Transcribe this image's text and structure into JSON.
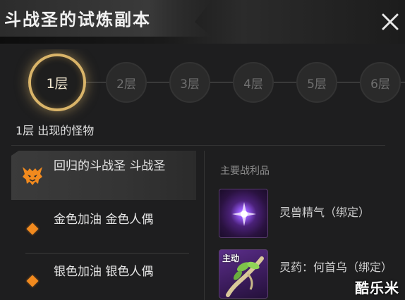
{
  "header": {
    "title": "斗战圣的试炼副本",
    "close_icon": "close-icon"
  },
  "floors": {
    "items": [
      {
        "label": "1层",
        "active": true
      },
      {
        "label": "2层",
        "active": false
      },
      {
        "label": "3层",
        "active": false
      },
      {
        "label": "4层",
        "active": false
      },
      {
        "label": "5层",
        "active": false
      },
      {
        "label": "6层",
        "active": false
      }
    ],
    "caption": "1层 出现的怪物"
  },
  "monsters": [
    {
      "name": "回归的斗战圣 斗战圣",
      "icon": "demon-head-icon",
      "selected": true
    },
    {
      "name": "金色加油 金色人偶",
      "icon": "orange-diamond-icon",
      "selected": false
    },
    {
      "name": "银色加油 银色人偶",
      "icon": "orange-diamond-icon",
      "selected": false
    }
  ],
  "loot": {
    "heading": "主要战利品",
    "items": [
      {
        "name": "灵兽精气（绑定）",
        "icon": "purple-spirit-orb-icon",
        "tag": ""
      },
      {
        "name": "灵药：何首乌（绑定）",
        "icon": "herb-root-icon",
        "tag": "主动"
      }
    ]
  },
  "watermark": "酷乐米",
  "colors": {
    "accent_gold": "#d9b469",
    "diamond_orange": "#f28a1e",
    "background": "#1e1e1f"
  }
}
